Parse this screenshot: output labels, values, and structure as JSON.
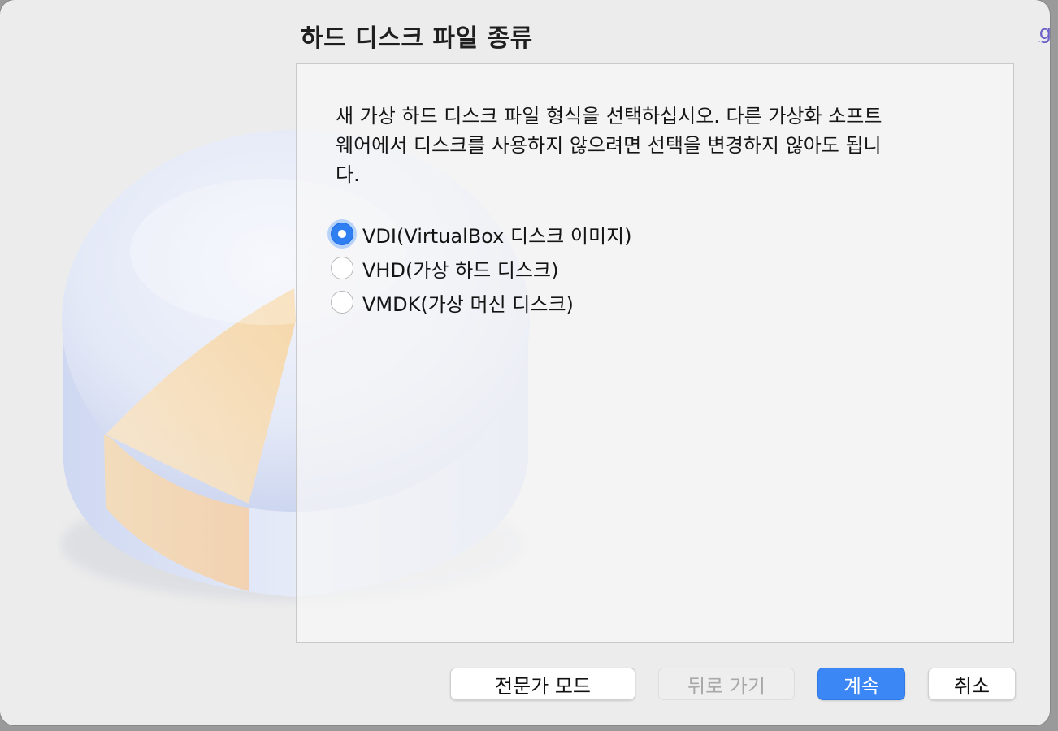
{
  "dialog": {
    "title": "하드 디스크 파일 종류",
    "edge_link_text": "g",
    "description": "새 가상 하드 디스크 파일 형식을 선택하십시오. 다른 가상화 소프트\n웨어에서 디스크를 사용하지 않으려면 선택을 변경하지 않아도 됩니\n다.",
    "options": [
      {
        "label": "VDI(VirtualBox 디스크 이미지)",
        "selected": true
      },
      {
        "label": "VHD(가상 하드 디스크)",
        "selected": false
      },
      {
        "label": "VMDK(가상 머신 디스크)",
        "selected": false
      }
    ],
    "buttons": {
      "expert_mode": "전문가 모드",
      "back": "뒤로 가기",
      "continue": "계속",
      "cancel": "취소"
    },
    "colors": {
      "accent": "#3b87f5",
      "disabled_text": "#a8a8a8",
      "pie_slice": "#f7d7a8",
      "disk_body": "#d8e0f4"
    },
    "illustration": "disk-pie-illustration"
  }
}
